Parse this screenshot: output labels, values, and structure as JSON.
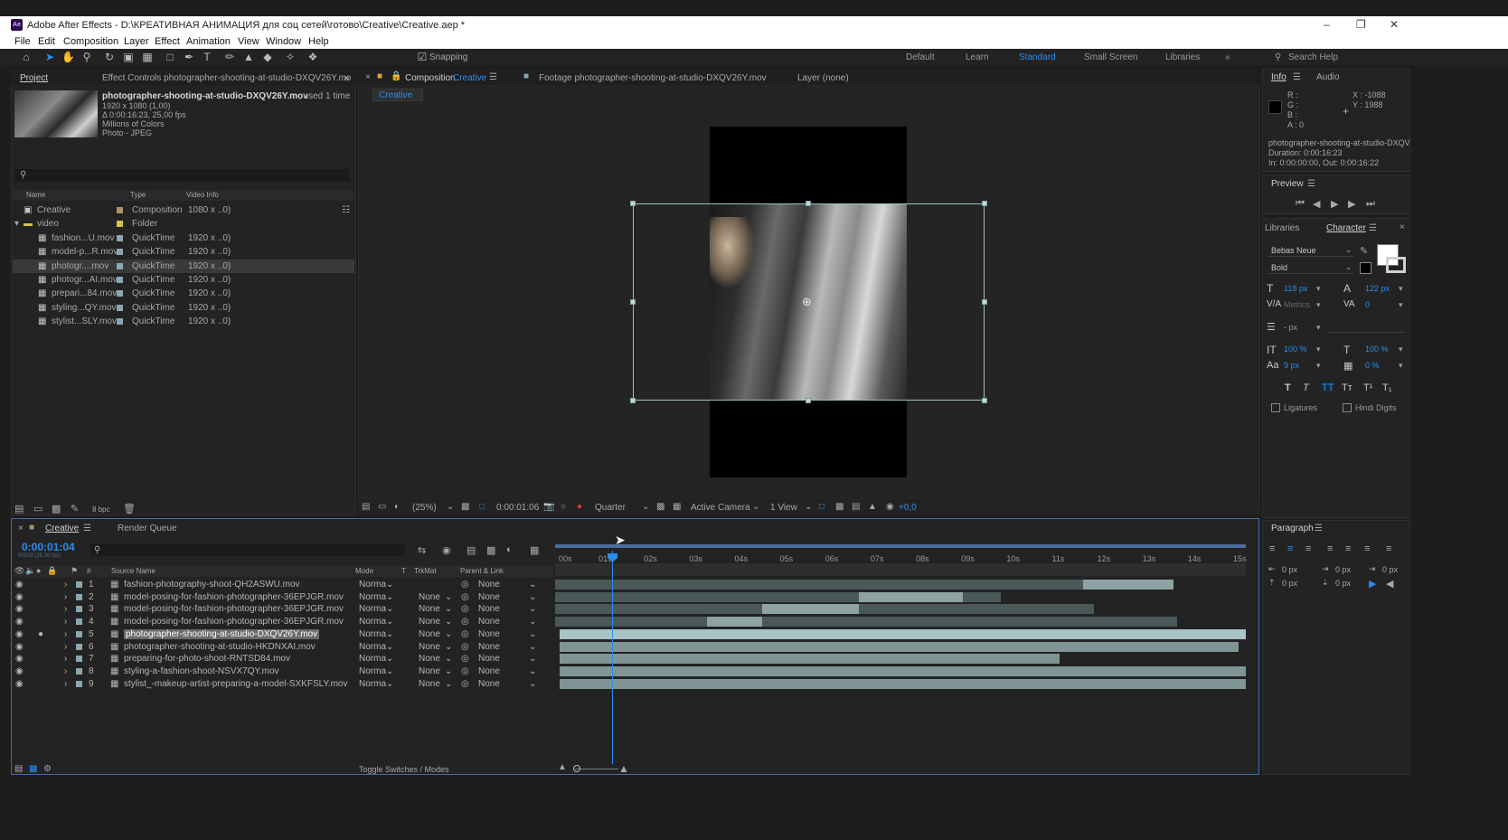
{
  "window": {
    "title": "Adobe After Effects - D:\\КРЕАТИВНАЯ АНИМАЦИЯ для соц сетей\\готово\\Creative\\Creative.aep *",
    "logo_text": "Ae"
  },
  "menu": [
    "File",
    "Edit",
    "Composition",
    "Layer",
    "Effect",
    "Animation",
    "View",
    "Window",
    "Help"
  ],
  "toolbar": {
    "snapping_label": "Snapping",
    "workspaces": [
      "Default",
      "Learn",
      "Standard",
      "Small Screen",
      "Libraries"
    ],
    "active_workspace": "Standard",
    "search_placeholder": "Search Help"
  },
  "project_panel": {
    "tab_project": "Project",
    "tab_effect_controls": "Effect Controls photographer-shooting-at-studio-DXQV26Y.mo",
    "selected_file": "photographer-shooting-at-studio-DXQV26Y.mov",
    "used_text": ", used 1 time",
    "info_lines": [
      "1920 x 1080 (1,00)",
      "Δ 0:00:16:23, 25,00 fps",
      "Millions of Colors",
      "Photo - JPEG"
    ],
    "columns": [
      "Name",
      "Type",
      "Video Info"
    ],
    "items": [
      {
        "name": "Creative",
        "type": "Composition",
        "info": "1080 x ..0)",
        "color": "#b0906a",
        "indent": 0
      },
      {
        "name": "video",
        "type": "Folder",
        "info": "",
        "color": "#d6c050",
        "indent": 0
      },
      {
        "name": "fashion...U.mov",
        "type": "QuickTime",
        "info": "1920 x ..0)",
        "color": "#8aa6b2",
        "indent": 1
      },
      {
        "name": "model-p...R.mov",
        "type": "QuickTime",
        "info": "1920 x ..0)",
        "color": "#8aa6b2",
        "indent": 1
      },
      {
        "name": "photogr....mov",
        "type": "QuickTime",
        "info": "1920 x ..0)",
        "color": "#8aa6b2",
        "indent": 1
      },
      {
        "name": "photogr...AI.mov",
        "type": "QuickTime",
        "info": "1920 x ..0)",
        "color": "#8aa6b2",
        "indent": 1
      },
      {
        "name": "prepari...84.mov",
        "type": "QuickTime",
        "info": "1920 x ..0)",
        "color": "#8aa6b2",
        "indent": 1
      },
      {
        "name": "styling...QY.mov",
        "type": "QuickTime",
        "info": "1920 x ..0)",
        "color": "#8aa6b2",
        "indent": 1
      },
      {
        "name": "stylist...SLY.mov",
        "type": "QuickTime",
        "info": "1920 x ..0)",
        "color": "#8aa6b2",
        "indent": 1
      }
    ],
    "bpc": "8 bpc"
  },
  "composition_panel": {
    "tab_composition": "Composition",
    "comp_name": "Creative",
    "tab_footage": "Footage photographer-shooting-at-studio-DXQV26Y.mov",
    "tab_layer": "Layer (none)",
    "breadcrumb": "Creative",
    "zoom": "(25%)",
    "timecode": "0:00:01:06",
    "resolution": "Quarter",
    "camera": "Active Camera",
    "views": "1 View",
    "exposure": "+0,0"
  },
  "info_panel": {
    "tab_info": "Info",
    "tab_audio": "Audio",
    "rgba": [
      "R :",
      "G :",
      "B :",
      "A : 0"
    ],
    "x": "X : -1088",
    "y": "Y : 1988",
    "file": "photographer-shooting-at-studio-DXQV",
    "duration": "Duration: 0:00:16:23",
    "in_out": "In: 0:00:00:00, Out: 0:00:16:22"
  },
  "preview_panel": {
    "title": "Preview"
  },
  "character_panel": {
    "tab_libraries": "Libraries",
    "tab_character": "Character",
    "font": "Bebas Neue",
    "style": "Bold",
    "font_size": "118 px",
    "leading": "122 px",
    "kerning": "Metrics",
    "tracking": "0",
    "stroke_unit": "- px",
    "vscale": "100 %",
    "hscale": "100 %",
    "baseline": "9 px",
    "tsume": "0 %",
    "ligatures": "Ligatures",
    "hindi_digits": "Hindi Digits"
  },
  "paragraph_panel": {
    "title": "Paragraph",
    "values": [
      "0 px",
      "0 px",
      "0 px",
      "0 px",
      "0 px"
    ]
  },
  "timeline": {
    "tab_comp": "Creative",
    "tab_render": "Render Queue",
    "current_time": "0:00:01:04",
    "frame_info": "00029 (25.00 fps)",
    "columns": [
      "#",
      "Source Name",
      "Mode",
      "T",
      "TrkMat",
      "Parent & Link"
    ],
    "ticks": [
      "00s",
      "01s",
      "02s",
      "03s",
      "04s",
      "05s",
      "06s",
      "07s",
      "08s",
      "09s",
      "10s",
      "11s",
      "12s",
      "13s",
      "14s",
      "15s"
    ],
    "toggle_label": "Toggle Switches / Modes",
    "layers": [
      {
        "num": "1",
        "name": "fashion-photography-shoot-QH2ASWU.mov",
        "mode": "Norma",
        "trkmat": "",
        "parent": "None",
        "bar_start": 0.0,
        "bar_end": 0.89,
        "light_start": 0.765,
        "light_end": 0.895
      },
      {
        "num": "2",
        "name": "model-posing-for-fashion-photographer-36EPJGR.mov",
        "mode": "Norma",
        "trkmat": "None",
        "parent": "None",
        "bar_start": 0.0,
        "bar_end": 0.645,
        "light_start": 0.44,
        "light_end": 0.59
      },
      {
        "num": "3",
        "name": "model-posing-for-fashion-photographer-36EPJGR.mov",
        "mode": "Norma",
        "trkmat": "None",
        "parent": "None",
        "bar_start": 0.0,
        "bar_end": 0.78,
        "light_start": 0.3,
        "light_end": 0.44
      },
      {
        "num": "4",
        "name": "model-posing-for-fashion-photographer-36EPJGR.mov",
        "mode": "Norma",
        "trkmat": "None",
        "parent": "None",
        "bar_start": 0.0,
        "bar_end": 0.9,
        "light_start": 0.22,
        "light_end": 0.3
      },
      {
        "num": "5",
        "name": "photographer-shooting-at-studio-DXQV26Y.mov",
        "mode": "Norma",
        "trkmat": "None",
        "parent": "None",
        "bar_start": 0.007,
        "bar_end": 1.0,
        "light_start": 0.007,
        "light_end": 1.0,
        "selected": true
      },
      {
        "num": "6",
        "name": "photographer-shooting-at-studio-HKDNXAI.mov",
        "mode": "Norma",
        "trkmat": "None",
        "parent": "None",
        "bar_start": 0.007,
        "bar_end": 0.99,
        "light_start": 0.0,
        "light_end": 0.0
      },
      {
        "num": "7",
        "name": "preparing-for-photo-shoot-RNTSD84.mov",
        "mode": "Norma",
        "trkmat": "None",
        "parent": "None",
        "bar_start": 0.007,
        "bar_end": 0.73,
        "light_start": 0.0,
        "light_end": 0.0
      },
      {
        "num": "8",
        "name": "styling-a-fashion-shoot-NSVX7QY.mov",
        "mode": "Norma",
        "trkmat": "None",
        "parent": "None",
        "bar_start": 0.007,
        "bar_end": 1.0,
        "light_start": 0.0,
        "light_end": 0.0
      },
      {
        "num": "9",
        "name": "stylist_-makeup-artist-preparing-a-model-SXKFSLY.mov",
        "mode": "Norma",
        "trkmat": "None",
        "parent": "None",
        "bar_start": 0.007,
        "bar_end": 1.0,
        "light_start": 0.0,
        "light_end": 0.0
      }
    ]
  }
}
